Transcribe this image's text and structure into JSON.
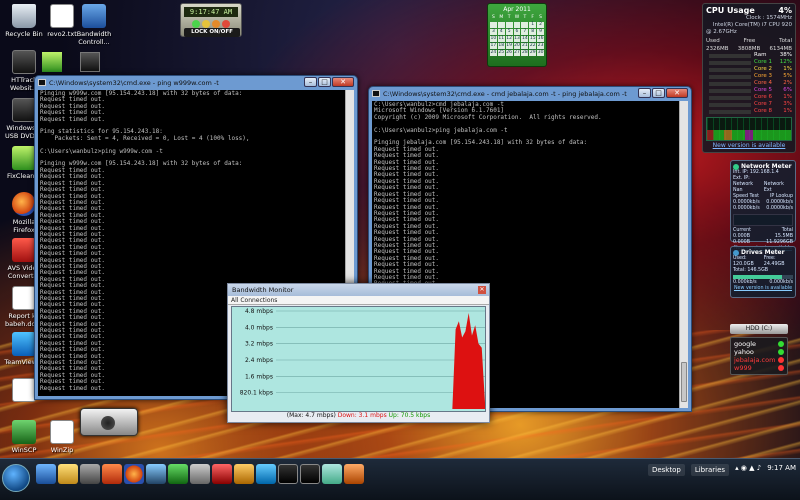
{
  "desktop": {
    "icons": [
      {
        "label": "Recycle Bin",
        "icon": "recycle-bin-icon"
      },
      {
        "label": "revo2.txt",
        "icon": "text-file-icon"
      },
      {
        "label": "Bandwidth Controll...",
        "icon": "network-icon"
      },
      {
        "label": "HTTrack Websit...",
        "icon": "httrack-icon"
      },
      {
        "label": "Windows 7 USB DVD ...",
        "icon": "usb-icon"
      },
      {
        "label": "FixCleaner",
        "icon": "fixcleaner-icon"
      },
      {
        "label": "Mozilla Firefox",
        "icon": "firefox-icon"
      },
      {
        "label": "AVS Video Converter",
        "icon": "video-converter-icon"
      },
      {
        "label": "Report ke babeh.docx",
        "icon": "document-icon"
      },
      {
        "label": "TeamViewer",
        "icon": "teamviewer-icon"
      },
      {
        "label": "WinSCP",
        "icon": "winscp-icon"
      },
      {
        "label": "WinZip",
        "icon": "winzip-icon"
      }
    ]
  },
  "clock_gadget": {
    "time": "9:17:47 AM",
    "lock_label": "LOCK ON/OFF"
  },
  "calendar": {
    "month": "Apr 2011",
    "days_header": [
      "S",
      "M",
      "T",
      "W",
      "T",
      "F",
      "S"
    ],
    "days": [
      "",
      "",
      "",
      "",
      "",
      "1",
      "2",
      "3",
      "4",
      "5",
      "6",
      "7",
      "8",
      "9",
      "10",
      "11",
      "12",
      "13",
      "14",
      "15",
      "16",
      "17",
      "18",
      "19",
      "20",
      "21",
      "22",
      "23",
      "24",
      "25",
      "26",
      "27",
      "28",
      "29",
      "30"
    ]
  },
  "cpu": {
    "title": "CPU Usage",
    "percent": "4%",
    "clock": "Clock : 1574MHz",
    "model": "Intel(R) Core(TM) i7 CPU 920",
    "speed": "@ 2.67GHz",
    "mem_labels": [
      "Used",
      "Free",
      "Total"
    ],
    "mem_values": [
      "2326MB",
      "3808MB",
      "6134MB"
    ],
    "ram": {
      "label": "Ram",
      "value": "38%"
    },
    "cores": [
      {
        "label": "Core 1",
        "value": "12%",
        "color": "#44dd44"
      },
      {
        "label": "Core 2",
        "value": "1%",
        "color": "#ffdd44"
      },
      {
        "label": "Core 3",
        "value": "5%",
        "color": "#ffaa33"
      },
      {
        "label": "Core 4",
        "value": "2%",
        "color": "#ff6644"
      },
      {
        "label": "Core 5",
        "value": "6%",
        "color": "#dd44dd"
      },
      {
        "label": "Core 6",
        "value": "1%",
        "color": "#ff4444"
      },
      {
        "label": "Core 7",
        "value": "3%",
        "color": "#ff4444"
      },
      {
        "label": "Core 8",
        "value": "1%",
        "color": "#ff4444"
      }
    ],
    "new_version": "New version is available"
  },
  "network_meter": {
    "title": "Network Meter",
    "internal_ip": "Int. IP: 192.168.1.4",
    "ext_ip": "Ext. IP:",
    "left_col": [
      "Network Nan",
      "Speed Test",
      "0.0000kb/s",
      "0.0000kb/s"
    ],
    "right_col": [
      "Network Ext",
      "IP Lookup",
      "0.0000kb/s",
      "0.0000kb/s"
    ],
    "current_label": "Current",
    "total_label": "Total",
    "current": [
      "0.000B",
      "0.000B"
    ],
    "total": [
      "15.5MB",
      "11.9296GB"
    ],
    "new_version": "New version is available"
  },
  "drives_meter": {
    "title": "Drives Meter",
    "used": "Used: 120.0GB",
    "free": "Free: 24.49GB",
    "total": "Total: 146.5GB",
    "rates": [
      "0.000kb/s",
      "0.000kb/s"
    ],
    "new_version": "New version is available"
  },
  "hdd": {
    "label": "HDD (C:)"
  },
  "status_list": [
    {
      "label": "google",
      "color": "#ffffff",
      "led": "#33dd33"
    },
    {
      "label": "yahoo",
      "color": "#ffffff",
      "led": "#33dd33"
    },
    {
      "label": "jebalaja.com",
      "color": "#ff3b3b",
      "led": "#ff3333"
    },
    {
      "label": "w999",
      "color": "#ff3b3b",
      "led": "#ff3333"
    }
  ],
  "cmd_left": {
    "title": "C:\\Windows\\system32\\cmd.exe - ping  w999w.com -t",
    "lines": [
      "Pinging w999w.com [95.154.243.18] with 32 bytes of data:",
      "Request timed out.",
      "Request timed out.",
      "Request timed out.",
      "Request timed out.",
      "",
      "Ping statistics for 95.154.243.18:",
      "    Packets: Sent = 4, Received = 0, Lost = 4 (100% loss),",
      "",
      "C:\\Users\\wanbulz>ping w999w.com -t",
      "",
      "Pinging w999w.com [95.154.243.18] with 32 bytes of data:",
      "Request timed out.",
      "Request timed out.",
      "Request timed out.",
      "Request timed out.",
      "Request timed out.",
      "Request timed out.",
      "Request timed out.",
      "Request timed out.",
      "Request timed out.",
      "Request timed out.",
      "Request timed out.",
      "Request timed out.",
      "Request timed out.",
      "Request timed out.",
      "Request timed out.",
      "Request timed out.",
      "Request timed out.",
      "Request timed out.",
      "Request timed out.",
      "Request timed out.",
      "Request timed out.",
      "Request timed out.",
      "Request timed out.",
      "Request timed out.",
      "Request timed out.",
      "Request timed out.",
      "Request timed out.",
      "Request timed out.",
      "Request timed out.",
      "Request timed out.",
      "Request timed out.",
      "Request timed out.",
      "Request timed out.",
      "Request timed out.",
      "Request timed out."
    ]
  },
  "cmd_right": {
    "title": "C:\\Windows\\system32\\cmd.exe - cmd  jebalaja.com -t - ping  jebalaja.com -t",
    "lines": [
      "C:\\Users\\wanbulz>cmd jebalaja.com -t",
      "Microsoft Windows [Version 6.1.7601]",
      "Copyright (c) 2009 Microsoft Corporation.  All rights reserved.",
      "",
      "C:\\Users\\wanbulz>ping jebalaja.com -t",
      "",
      "Pinging jebalaja.com [95.154.243.18] with 32 bytes of data:",
      "Request timed out.",
      "Request timed out.",
      "Request timed out.",
      "Request timed out.",
      "Request timed out.",
      "Request timed out.",
      "Request timed out.",
      "Request timed out.",
      "Request timed out.",
      "Request timed out.",
      "Request timed out.",
      "Request timed out.",
      "Request timed out.",
      "Request timed out.",
      "Request timed out.",
      "Request timed out.",
      "Request timed out.",
      "Request timed out.",
      "Request timed out.",
      "Request timed out.",
      "Request timed out.",
      "Request timed out.",
      "Request timed out.",
      "Request timed out.",
      "Request timed out.",
      "Request timed out.",
      "Request timed out.",
      "Request timed out.",
      "Request timed out.",
      "Request timed out.",
      "Request timed out.",
      "Request timed out.",
      "Request timed out.",
      "Request timed out.",
      "Request timed out.",
      "Request timed out.",
      "Request timed out.",
      "Request timed out.",
      "Request timed out.",
      "Request timed out.",
      "Request timed out.",
      "Request timed out."
    ]
  },
  "bandwidth_monitor": {
    "title": "Bandwidth Monitor",
    "tab": "All Connections",
    "status_max": "(Max: 4.7 mbps)",
    "status_down": "Down: 3.1 mbps",
    "status_up": "Up: 70.5 kbps"
  },
  "chart_data": {
    "type": "area",
    "title": "",
    "xlabel": "",
    "ylabel": "",
    "y_ticks": [
      "4.8 mbps",
      "4.0 mbps",
      "3.2 mbps",
      "2.4 mbps",
      "1.6 mbps",
      "820.1 kbps"
    ],
    "ylim": [
      0,
      4.8
    ],
    "series": [
      {
        "values": [
          0,
          0,
          0,
          0,
          0,
          0,
          0,
          0,
          0,
          0,
          0,
          0,
          0,
          0,
          0,
          0,
          0,
          0,
          0,
          0,
          0,
          0,
          0,
          0,
          0,
          0,
          0,
          0,
          0,
          0,
          0,
          0,
          0,
          0,
          0,
          0,
          0,
          0,
          0,
          0,
          0,
          0,
          0,
          0,
          0,
          0,
          0,
          0,
          0,
          0,
          0,
          0,
          0,
          0,
          0,
          3.9,
          4.3,
          3.5,
          3.8,
          4.7,
          3.6,
          4.1,
          3.2,
          3.0,
          0.3
        ]
      }
    ],
    "colors": {
      "series": "#dd1111",
      "background": "#aee6e0",
      "grid": "#6fa8a4"
    },
    "grid": true
  },
  "taskbar": {
    "desktop_label": "Desktop",
    "libraries_label": "Libraries",
    "time": "9:17 AM"
  }
}
